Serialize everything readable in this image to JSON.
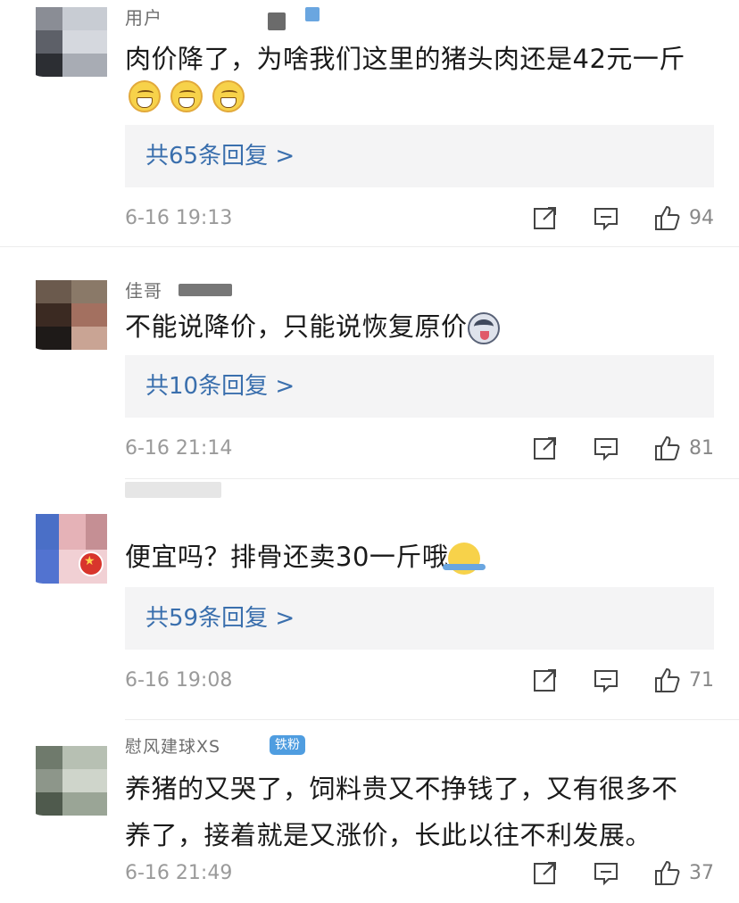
{
  "comments": [
    {
      "username": "用户",
      "text": "肉价降了，为啥我们这里的猪头肉还是42元一斤",
      "emojis": [
        "grin-emoji",
        "grin-emoji",
        "grin-emoji"
      ],
      "reply_label": "共65条回复 >",
      "date": "6-16 19:13",
      "likes": "94"
    },
    {
      "username": "佳哥",
      "text": "不能说降价，只能说恢复原价",
      "emojis": [
        "husky-emoji"
      ],
      "reply_label": "共10条回复 >",
      "date": "6-16 21:14",
      "likes": "81"
    },
    {
      "username": "",
      "text": "便宜吗？排骨还卖30一斤哦",
      "emojis": [
        "shrug-emoji"
      ],
      "reply_label": "共59条回复 >",
      "date": "6-16 19:08",
      "likes": "71"
    },
    {
      "username": "慰风建球XS",
      "badge": "铁粉",
      "text_line1": "养猪的又哭了，饲料贵又不挣钱了，又有很多不",
      "text_line2": "养了，接着就是又涨价，长此以往不利发展。",
      "date": "6-16 21:49",
      "likes": "37"
    }
  ],
  "icons": {
    "share": "share-icon",
    "comment": "comment-icon",
    "like": "thumbs-up-icon"
  },
  "colors": {
    "reply_link": "#3a6fad",
    "meta_text": "#9a9a9a",
    "reply_bg": "#f4f4f5"
  }
}
